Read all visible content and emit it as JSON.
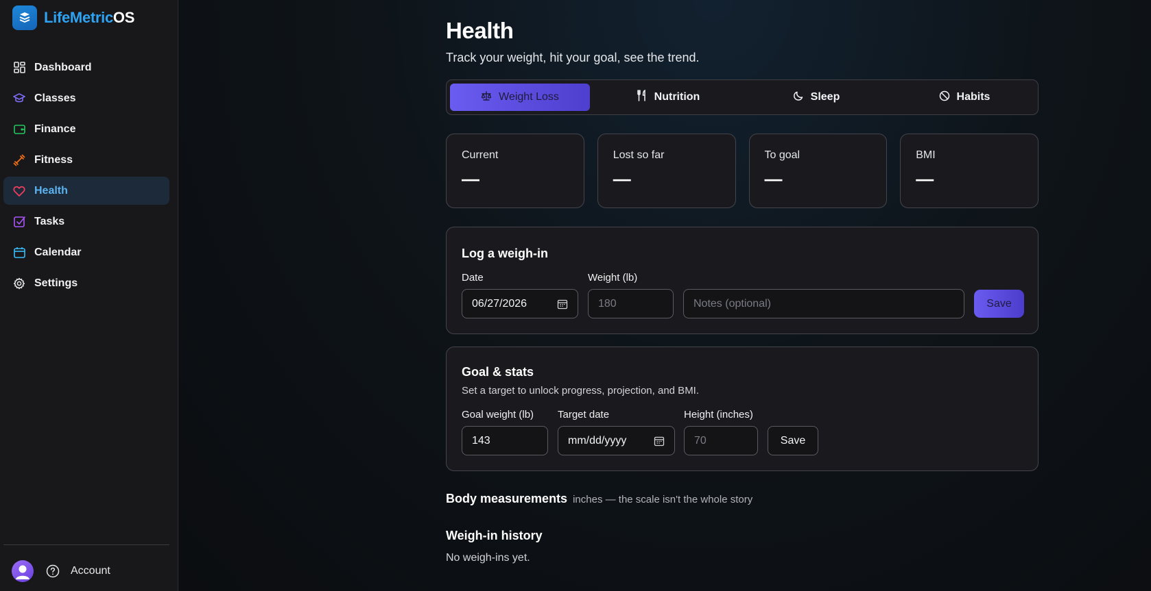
{
  "brand": {
    "name_a": "LifeMetric",
    "name_b": "OS",
    "logo_icon": "stack-layers-icon"
  },
  "sidebar": {
    "items": [
      {
        "label": "Dashboard",
        "icon": "grid-icon",
        "color": "#e5e7eb"
      },
      {
        "label": "Classes",
        "icon": "graduation-cap-icon",
        "color": "#7c6cf2"
      },
      {
        "label": "Finance",
        "icon": "wallet-icon",
        "color": "#22c55e"
      },
      {
        "label": "Fitness",
        "icon": "dumbbell-icon",
        "color": "#f97316"
      },
      {
        "label": "Health",
        "icon": "heart-icon",
        "color": "#f43f5e",
        "active": true
      },
      {
        "label": "Tasks",
        "icon": "checkbox-icon",
        "color": "#a855f7"
      },
      {
        "label": "Calendar",
        "icon": "calendar-icon",
        "color": "#38bdf8"
      },
      {
        "label": "Settings",
        "icon": "gear-icon",
        "color": "#e5e7eb"
      }
    ],
    "account_label": "Account"
  },
  "page": {
    "title": "Health",
    "subtitle": "Track your weight, hit your goal, see the trend."
  },
  "tabs": [
    {
      "label": "Weight Loss",
      "icon": "scale-icon",
      "active": true
    },
    {
      "label": "Nutrition",
      "icon": "utensils-icon"
    },
    {
      "label": "Sleep",
      "icon": "moon-icon"
    },
    {
      "label": "Habits",
      "icon": "ban-icon"
    }
  ],
  "stats": [
    {
      "label": "Current",
      "value": "—"
    },
    {
      "label": "Lost so far",
      "value": "—"
    },
    {
      "label": "To goal",
      "value": "—"
    },
    {
      "label": "BMI",
      "value": "—"
    }
  ],
  "log": {
    "title": "Log a weigh-in",
    "date_label": "Date",
    "date_value": "06/27/2026",
    "weight_label": "Weight (lb)",
    "weight_placeholder": "180",
    "notes_placeholder": "Notes (optional)",
    "save_label": "Save"
  },
  "goal": {
    "title": "Goal & stats",
    "description": "Set a target to unlock progress, projection, and BMI.",
    "goal_weight_label": "Goal weight (lb)",
    "goal_weight_value": "143",
    "target_date_label": "Target date",
    "target_date_value": "mm/dd/yyyy",
    "height_label": "Height (inches)",
    "height_placeholder": "70",
    "save_label": "Save"
  },
  "measurements": {
    "title": "Body measurements",
    "note": "inches — the scale isn't the whole story"
  },
  "history": {
    "title": "Weigh-in history",
    "empty": "No weigh-ins yet."
  },
  "colors": {
    "accent": "#5b4ee6",
    "active_nav_text": "#5bb3f0",
    "brand_blue": "#2ea3f2"
  }
}
